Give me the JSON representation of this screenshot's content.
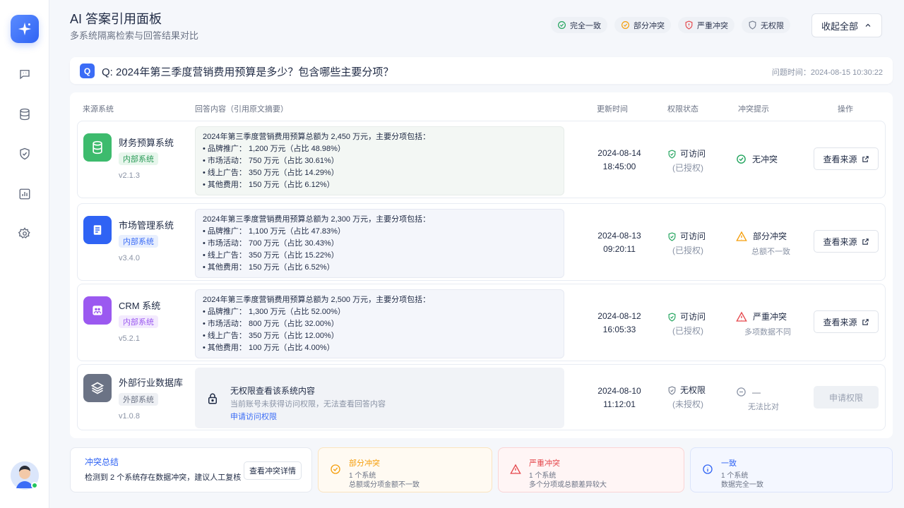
{
  "app": {
    "title": "AI 答案引用面板",
    "subtitle": "多系统隔离检索与回答结果对比",
    "collapse_label": "收起全部"
  },
  "legend": [
    {
      "label": "完全一致",
      "icon": "check-circle-icon",
      "color": "#22a45d"
    },
    {
      "label": "部分冲突",
      "icon": "warning-circle-icon",
      "color": "#f59e0b"
    },
    {
      "label": "严重冲突",
      "icon": "alert-shield-icon",
      "color": "#e5484d"
    },
    {
      "label": "无权限",
      "icon": "shield-icon",
      "color": "#7b8394"
    }
  ],
  "question": {
    "badge": "Q",
    "text": "Q: 2024年第三季度营销费用预算是多少？包含哪些主要分项？",
    "time": "问题时间：2024-08-15 10:30:22"
  },
  "table": {
    "headers": [
      "来源系统",
      "回答内容（引用原文摘要）",
      "更新时间",
      "权限状态",
      "冲突提示",
      "操作"
    ],
    "rows": [
      {
        "system": "财务预算系统",
        "tag": "内部系统",
        "version": "v2.1.3",
        "icon": "database-icon",
        "icon_color": "#3dbb6d",
        "answer": [
          "2024年第三季度营销费用预算总额为 2,450 万元，主要分项包括：",
          "• 品牌推广： 1,200 万元（占比 48.98%）",
          "• 市场活动： 750 万元（占比 30.61%）",
          "• 线上广告： 350 万元（占比 14.29%）",
          "• 其他费用： 150 万元（占比 6.12%）"
        ],
        "date": "2024-08-14",
        "time": "18:45:00",
        "perm": "可访问",
        "perm_sub": "(已授权)",
        "conflict": "无冲突",
        "conflict_sub": "",
        "action": "查看来源"
      },
      {
        "system": "市场管理系统",
        "tag": "内部系统",
        "version": "v3.4.0",
        "icon": "document-icon",
        "icon_color": "#2f63f4",
        "answer": [
          "2024年第三季度营销费用预算总额为 2,300 万元，主要分项包括：",
          "• 品牌推广： 1,100 万元（占比 47.83%）",
          "• 市场活动： 700 万元（占比 30.43%）",
          "• 线上广告： 350 万元（占比 15.22%）",
          "• 其他费用： 150 万元（占比 6.52%）"
        ],
        "date": "2024-08-13",
        "time": "09:20:11",
        "perm": "可访问",
        "perm_sub": "(已授权)",
        "conflict": "部分冲突",
        "conflict_sub": "总额不一致",
        "action": "查看来源"
      },
      {
        "system": "CRM 系统",
        "tag": "内部系统",
        "version": "v5.2.1",
        "icon": "users-icon",
        "icon_color": "#9b59f0",
        "answer": [
          "2024年第三季度营销费用预算总额为 2,500 万元，主要分项包括：",
          "• 品牌推广： 1,300 万元（占比 52.00%）",
          "• 市场活动： 800 万元（占比 32.00%）",
          "• 线上广告： 350 万元（占比 12.00%）",
          "• 其他费用： 100 万元（占比 4.00%）"
        ],
        "date": "2024-08-12",
        "time": "16:05:33",
        "perm": "可访问",
        "perm_sub": "(已授权)",
        "conflict": "严重冲突",
        "conflict_sub": "多项数据不同",
        "action": "查看来源"
      },
      {
        "system": "外部行业数据库",
        "tag": "外部系统",
        "version": "v1.0.8",
        "icon": "layers-icon",
        "icon_color": "#6b7385",
        "locked_title": "无权限查看该系统内容",
        "locked_desc": "当前账号未获得访问权限，无法查看回答内容",
        "locked_link": "申请访问权限",
        "date": "2024-08-10",
        "time": "11:12:01",
        "perm": "无权限",
        "perm_sub": "(未授权)",
        "conflict": "—",
        "conflict_sub": "无法比对",
        "action": "申请权限"
      }
    ]
  },
  "summary": {
    "title": "冲突总结",
    "desc": "检测到 2 个系统存在数据冲突，建议人工复核",
    "button": "查看冲突详情",
    "stats": [
      {
        "title": "部分冲突",
        "count": "1 个系统",
        "desc": "总额或分项金额不一致",
        "color": "#f59e0b"
      },
      {
        "title": "严重冲突",
        "count": "1 个系统",
        "desc": "多个分项或总额差异较大",
        "color": "#e5484d"
      },
      {
        "title": "一致",
        "count": "1 个系统",
        "desc": "数据完全一致",
        "color": "#2f63f4"
      }
    ]
  }
}
